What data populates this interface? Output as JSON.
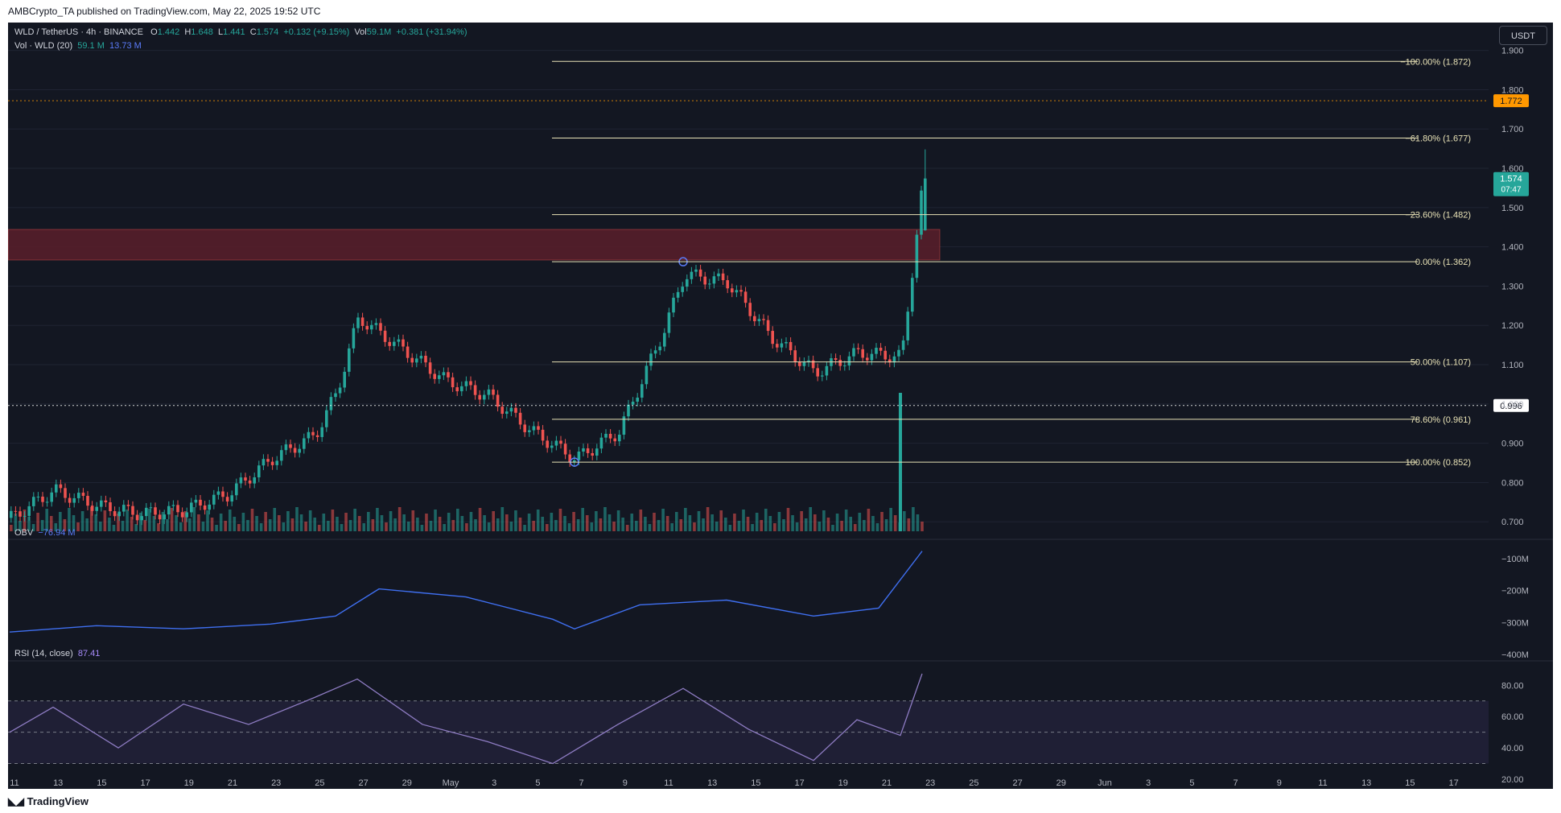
{
  "header": {
    "publisher_line": "AMBCrypto_TA published on TradingView.com, May 22, 2025 19:52 UTC"
  },
  "legend": {
    "symbol": "WLD / TetherUS · 4h · BINANCE",
    "o_label": "O",
    "o": "1.442",
    "h_label": "H",
    "h": "1.648",
    "l_label": "L",
    "l": "1.441",
    "c_label": "C",
    "c": "1.574",
    "change": "+0.132 (+9.15%)",
    "vol_label": "Vol",
    "vol": "59.1M",
    "vol_change": "+0.381 (+31.94%)",
    "vol_indicator": "Vol · WLD (20)",
    "vol_value": "59.1 M",
    "vol_ma": "13.73 M",
    "obv_label": "OBV",
    "obv_value": "−76.94 M",
    "rsi_label": "RSI (14, close)",
    "rsi_value": "87.41"
  },
  "quote_currency": "USDT",
  "footer": {
    "brand": "TradingView"
  },
  "colors": {
    "up": "#26a69a",
    "down": "#ef5350",
    "obv": "#3f6ff0",
    "rsi": "#8e7cc3",
    "fib": "#e8e2b6",
    "zone": "#5a1f2a",
    "accent": "#ff9800"
  },
  "chart_data": [
    {
      "type": "candlestick",
      "title": "WLD / TetherUS · 4h · BINANCE",
      "y_axis_ticks": [
        "1.900",
        "1.800",
        "1.700",
        "1.600",
        "1.500",
        "1.400",
        "1.300",
        "1.200",
        "1.100",
        "1.000",
        "0.900",
        "0.800",
        "0.700"
      ],
      "ylim": [
        0.68,
        1.93
      ],
      "x_axis_ticks": [
        "11",
        "13",
        "15",
        "17",
        "19",
        "21",
        "23",
        "25",
        "27",
        "29",
        "May",
        "3",
        "5",
        "7",
        "9",
        "11",
        "13",
        "15",
        "17",
        "19",
        "21",
        "23",
        "25",
        "27",
        "29",
        "Jun",
        "3",
        "5",
        "7",
        "9",
        "11",
        "13",
        "15",
        "17"
      ],
      "price_labels": [
        {
          "label": "1.772",
          "value": 1.772,
          "color": "#ff9800"
        },
        {
          "label": "1.574",
          "sublabel": "07:47",
          "value": 1.574,
          "color": "#26a69a"
        },
        {
          "label": "0.996",
          "value": 0.996,
          "color": "#ffffff"
        }
      ],
      "fib_levels": [
        {
          "label": "−100.00% (1.872)",
          "value": 1.872
        },
        {
          "label": "−61.80% (1.677)",
          "value": 1.677
        },
        {
          "label": "−23.60% (1.482)",
          "value": 1.482
        },
        {
          "label": "0.00% (1.362)",
          "value": 1.362
        },
        {
          "label": "50.00% (1.107)",
          "value": 1.107
        },
        {
          "label": "78.60% (0.961)",
          "value": 0.961
        },
        {
          "label": "100.00% (0.852)",
          "value": 0.852
        }
      ],
      "resistance_zone": [
        1.39,
        1.475
      ],
      "anchor_points": [
        {
          "date": "May 6",
          "value": 0.852
        },
        {
          "date": "May 11",
          "value": 1.362
        }
      ],
      "series": [
        {
          "type": "close",
          "x": [
            "Apr 10",
            "Apr 12",
            "Apr 14",
            "Apr 16",
            "Apr 18",
            "Apr 20",
            "Apr 22",
            "Apr 24",
            "Apr 25",
            "Apr 26",
            "Apr 28",
            "Apr 30",
            "May 2",
            "May 4",
            "May 6",
            "May 8",
            "May 10",
            "May 11",
            "May 13",
            "May 15",
            "May 17",
            "May 19",
            "May 21",
            "May 22"
          ],
          "values": [
            0.71,
            0.78,
            0.74,
            0.72,
            0.73,
            0.77,
            0.86,
            0.92,
            1.03,
            1.22,
            1.14,
            1.06,
            1.02,
            0.93,
            0.86,
            0.93,
            1.18,
            1.33,
            1.31,
            1.17,
            1.08,
            1.13,
            1.12,
            1.574
          ]
        }
      ]
    },
    {
      "type": "bar",
      "title": "Vol · WLD (20)",
      "description": "volume histogram with 20-period MA",
      "values": [
        59.1
      ],
      "ma": [
        13.73
      ]
    },
    {
      "type": "line",
      "title": "OBV",
      "y_axis_ticks": [
        "−100M",
        "−200M",
        "−300M",
        "−400M"
      ],
      "x": [
        "Apr 10",
        "Apr 14",
        "Apr 18",
        "Apr 22",
        "Apr 25",
        "Apr 27",
        "May 1",
        "May 5",
        "May 6",
        "May 9",
        "May 13",
        "May 17",
        "May 20",
        "May 22"
      ],
      "values": [
        -330,
        -310,
        -320,
        -305,
        -280,
        -195,
        -220,
        -290,
        -320,
        -245,
        -230,
        -280,
        -255,
        -76.94
      ]
    },
    {
      "type": "line",
      "title": "RSI (14, close)",
      "y_axis_ticks": [
        "80.00",
        "60.00",
        "40.00",
        "20.00"
      ],
      "bands": [
        30,
        50,
        70
      ],
      "x": [
        "Apr 10",
        "Apr 12",
        "Apr 15",
        "Apr 18",
        "Apr 21",
        "Apr 24",
        "Apr 26",
        "Apr 29",
        "May 2",
        "May 5",
        "May 8",
        "May 11",
        "May 14",
        "May 17",
        "May 19",
        "May 21",
        "May 22"
      ],
      "values": [
        50,
        66,
        40,
        68,
        55,
        72,
        84,
        55,
        44,
        30,
        55,
        78,
        52,
        32,
        58,
        48,
        87.41
      ]
    }
  ]
}
